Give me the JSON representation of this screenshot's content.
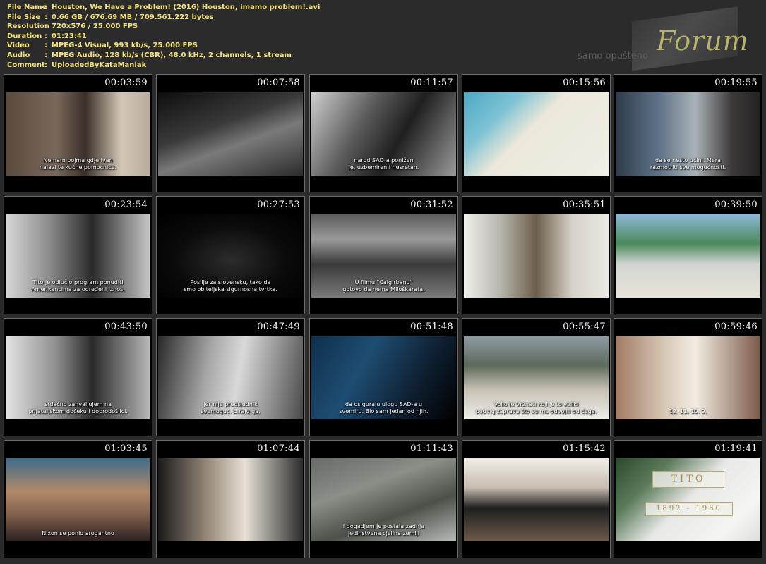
{
  "meta": [
    {
      "label": "File Name",
      "value": "Houston, We Have a Problem! (2016) Houston, imamo problem!.avi"
    },
    {
      "label": "File Size",
      "value": "0.66 GB  / 676.69 MB  / 709.561.222  bytes"
    },
    {
      "label": "Resolution",
      "value": "720x576 / 25.000 FPS"
    },
    {
      "label": "Duration",
      "value": "01:23:41"
    },
    {
      "label": "Video",
      "value": "MPEG-4 Visual, 993 kb/s, 25.000 FPS"
    },
    {
      "label": "Audio",
      "value": "MPEG Audio, 128 kb/s (CBR), 48.0 kHz, 2 channels, 1 stream"
    },
    {
      "label": "Comment",
      "value": "UploadedByKataManiak"
    }
  ],
  "colon": ":",
  "logo": {
    "word": "Forum",
    "tagline": "samo opušteno"
  },
  "thumbnails": [
    {
      "time": "00:03:59",
      "subtitle": "Nemam pojma gdje Ivan\nnalazi te kućne pomoćnice.",
      "scene": "interior"
    },
    {
      "time": "00:07:58",
      "subtitle": "",
      "scene": "bw1"
    },
    {
      "time": "00:11:57",
      "subtitle": "narod SAD-a ponižen\nje, uzbemiren i nesretan.",
      "scene": "bw2"
    },
    {
      "time": "00:15:56",
      "subtitle": "",
      "scene": "map"
    },
    {
      "time": "00:19:55",
      "subtitle": "da se nešto učini. Mera\nrazmotriti sve mogućnosti.",
      "scene": "color1"
    },
    {
      "time": "00:23:54",
      "subtitle": "Tito je odlučio program ponuditi\nAmerikancima za određeni iznos.",
      "scene": "bw3"
    },
    {
      "time": "00:27:53",
      "subtitle": "Poslije za slovensku, tako da\nsmo obiteljska sigurnosna tvrtka.",
      "scene": "studio"
    },
    {
      "time": "00:31:52",
      "subtitle": "U filmu \"Calgirbanu\"\ngotovo da nema Miloškarata.",
      "scene": "crowd"
    },
    {
      "time": "00:35:51",
      "subtitle": "",
      "scene": "corridor"
    },
    {
      "time": "00:39:50",
      "subtitle": "",
      "scene": "beach"
    },
    {
      "time": "00:43:50",
      "subtitle": "srdačno zahvaljujem na\nprijateljskom dočeku i dobrodošlici.",
      "scene": "bw4"
    },
    {
      "time": "00:47:49",
      "subtitle": "jer nije predsjednik\nsvemoguć. Biraju ga.",
      "scene": "bw5"
    },
    {
      "time": "00:51:48",
      "subtitle": "da osiguraju ulogu SAD-a u\nsvemiru. Bio sam jedan od njih.",
      "scene": "color2"
    },
    {
      "time": "00:55:47",
      "subtitle": "Volio je Vrznati koji je to veliki\npodvig zaprava što su me odvojili od čega.",
      "scene": "color3"
    },
    {
      "time": "00:59:46",
      "subtitle": "12. 11. 10. 9.",
      "scene": "closeup"
    },
    {
      "time": "01:03:45",
      "subtitle": "Nixon se ponio arogantno",
      "scene": "color4"
    },
    {
      "time": "01:07:44",
      "subtitle": "",
      "scene": "color5"
    },
    {
      "time": "01:11:43",
      "subtitle": "i dogadjem je postala zadnja\njedinstvena cjelina zemlji",
      "scene": "aerial"
    },
    {
      "time": "01:15:42",
      "subtitle": "",
      "scene": "hall"
    },
    {
      "time": "01:19:41",
      "subtitle": "",
      "scene": "tomb",
      "plate": "TITO",
      "dates": "1892 - 1980"
    }
  ]
}
